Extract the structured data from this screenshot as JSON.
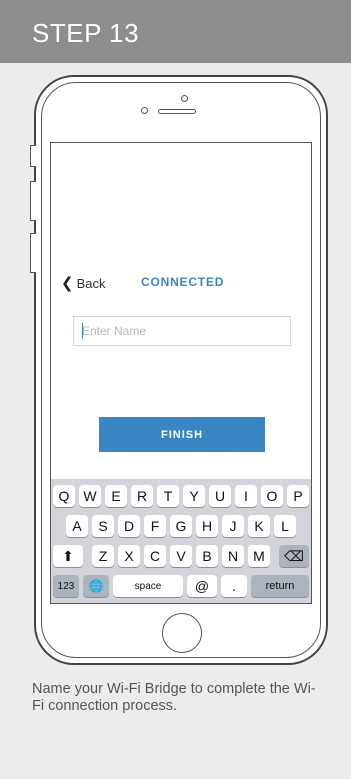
{
  "header": {
    "title": "STEP 13",
    "color": "#8d8d8d"
  },
  "screen": {
    "nav": {
      "back_label": "Back",
      "title": "CONNECTED"
    },
    "name_input": {
      "placeholder": "Enter Name",
      "value": ""
    },
    "finish_label": "FINISH",
    "accent": "#3a86c4"
  },
  "keyboard": {
    "row1": [
      "Q",
      "W",
      "E",
      "R",
      "T",
      "Y",
      "U",
      "I",
      "O",
      "P"
    ],
    "row2": [
      "A",
      "S",
      "D",
      "F",
      "G",
      "H",
      "J",
      "K",
      "L"
    ],
    "row3": [
      "Z",
      "X",
      "C",
      "V",
      "B",
      "N",
      "M"
    ],
    "shift": "⬆",
    "delete": "⌫",
    "numbers": "123",
    "globe": "🌐",
    "space": "space",
    "at": "@",
    "dot": ".",
    "return": "return"
  },
  "caption": "Name your Wi-Fi Bridge to complete the Wi-Fi connection process."
}
